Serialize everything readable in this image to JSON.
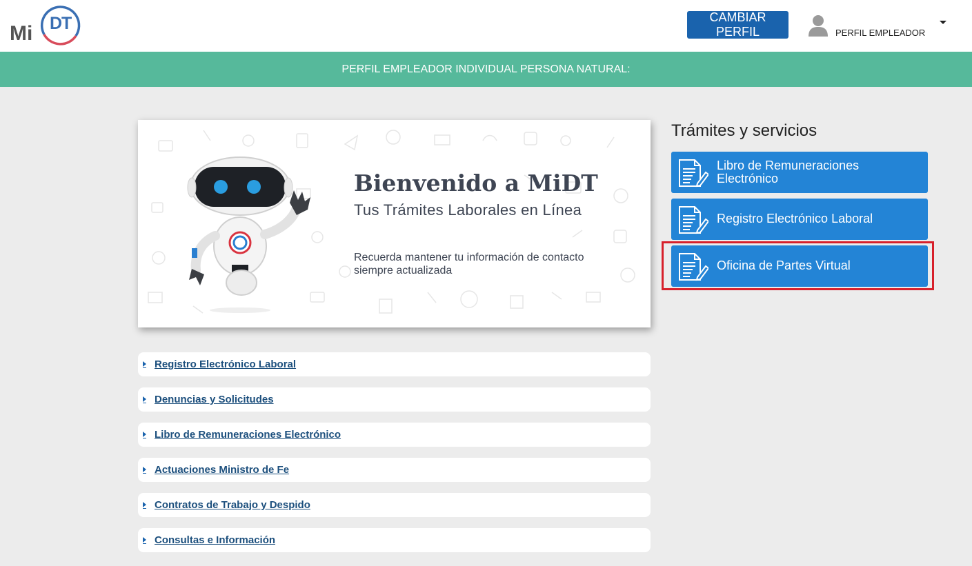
{
  "header": {
    "logo_text_mi": "Mi",
    "logo_text_dt": "DT",
    "change_profile_label": "CAMBIAR PERFIL",
    "user_profile_label": "PERFIL EMPLEADOR"
  },
  "profile_banner": {
    "text": "PERFIL EMPLEADOR INDIVIDUAL PERSONA NATURAL:"
  },
  "welcome": {
    "title": "Bienvenido a MiDT",
    "subtitle": "Tus Trámites Laborales en Línea",
    "note": "Recuerda mantener tu información de contacto siempre actualizada"
  },
  "accordion": {
    "items": [
      {
        "label": "Registro Electrónico Laboral"
      },
      {
        "label": "Denuncias y Solicitudes"
      },
      {
        "label": "Libro de Remuneraciones Electrónico"
      },
      {
        "label": "Actuaciones Ministro de Fe"
      },
      {
        "label": "Contratos de Trabajo y Despido"
      },
      {
        "label": "Consultas e Información"
      }
    ]
  },
  "services": {
    "title": "Trámites y servicios",
    "items": [
      {
        "label": "Libro de Remuneraciones Electrónico",
        "icon": "document-edit-icon"
      },
      {
        "label": "Registro Electrónico Laboral",
        "icon": "document-edit-icon"
      },
      {
        "label": "Oficina de Partes Virtual",
        "icon": "document-edit-icon"
      }
    ]
  },
  "colors": {
    "primary_blue": "#1a63ad",
    "service_blue": "#2384d6",
    "green_bar": "#56b99b",
    "highlight_red": "#d7202b",
    "background": "#ececec"
  }
}
